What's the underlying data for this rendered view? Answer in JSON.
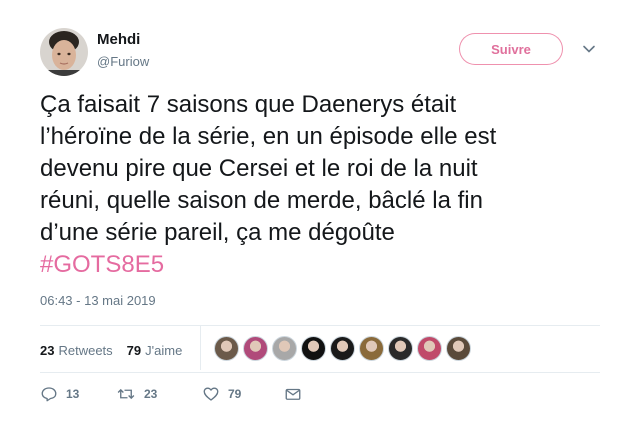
{
  "user": {
    "display_name": "Mehdi",
    "handle": "@Furiow"
  },
  "follow_button": {
    "label": "Suivre"
  },
  "tweet": {
    "text": "Ça faisait 7 saisons que Daenerys était\nl’héroïne de la série, en un épisode elle est\ndevenu pire que Cersei et le roi de la nuit\nréuni, quelle saison de merde, bâclé la fin\nd’une série pareil, ça me dégoûte\n",
    "hashtag": "#GOTS8E5",
    "timestamp": "06:43 - 13 mai 2019"
  },
  "stats": {
    "retweets_count": "23",
    "retweets_label": "Retweets",
    "likes_count": "79",
    "likes_label": "J'aime"
  },
  "liker_avatars": [
    {
      "color": "#6b5a4a"
    },
    {
      "color": "#b04a7a"
    },
    {
      "color": "#a8a8a8"
    },
    {
      "color": "#111111"
    },
    {
      "color": "#1a1a1a"
    },
    {
      "color": "#8a6a3a"
    },
    {
      "color": "#2a2a2a"
    },
    {
      "color": "#c04a6a"
    },
    {
      "color": "#5a4a3a"
    }
  ],
  "actions": {
    "reply_count": "13",
    "retweet_count": "23",
    "like_count": "79"
  },
  "colors": {
    "accent": "#e56ba0",
    "muted": "#657786",
    "border": "#e6ecf0"
  }
}
